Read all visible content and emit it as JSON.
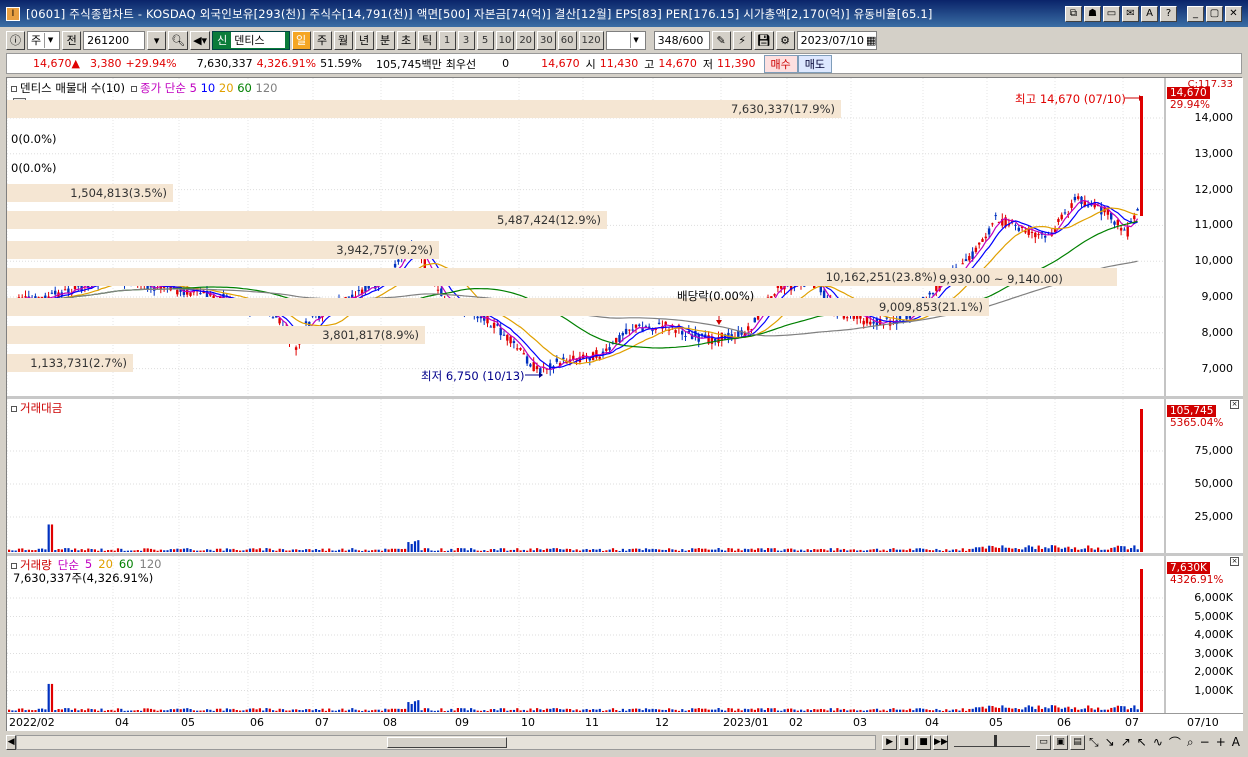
{
  "window": {
    "app_icon": "I",
    "title": "[0601] 주식종합차트 - KOSDAQ 외국인보유[293(천)] 주식수[14,791(천)] 액면[500] 자본금[74(억)] 결산[12월] EPS[83] PER[176.15] 시가총액[2,170(억)] 유동비율[65.1]",
    "title_buttons": [
      "⧉",
      "☗",
      "▭",
      "✉",
      "A",
      "?"
    ],
    "window_controls": [
      "_",
      "▢",
      "✕"
    ]
  },
  "toolbar": {
    "type_select": "주",
    "prev_label": "전",
    "code": "261200",
    "stock_tag": "신",
    "stock_name": "덴티스",
    "periods": [
      "일",
      "주",
      "월",
      "년",
      "분",
      "초",
      "틱"
    ],
    "active_period": "일",
    "intervals": [
      "1",
      "3",
      "5",
      "10",
      "20",
      "30",
      "60",
      "120"
    ],
    "count_value": "348",
    "count_total": "/600",
    "date": "2023/07/10"
  },
  "quote": {
    "price": "14,670",
    "arrow": "▲",
    "change": "3,380",
    "change_pct": "+29.94%",
    "volume": "7,630,337",
    "volume_pct": "4,326.91%",
    "turnover": "51.59%",
    "amount": "105,745백만",
    "bid_label": "최우선",
    "bid_value": "0",
    "ask_value": "14,670",
    "open_label": "시",
    "open": "11,430",
    "high_label": "고",
    "high": "14,670",
    "low_label": "저",
    "low": "11,390",
    "buy_label": "매수",
    "sell_label": "매도"
  },
  "price_pane": {
    "legend_title": "덴티스 매물대 수(10)",
    "ma_label": "종가 단순",
    "ma_periods": [
      {
        "label": "5",
        "color": "#c000c0"
      },
      {
        "label": "10",
        "color": "#0000ff"
      },
      {
        "label": "20",
        "color": "#e0a000"
      },
      {
        "label": "60",
        "color": "#008000"
      },
      {
        "label": "120",
        "color": "#808080"
      }
    ],
    "volume_profile": [
      {
        "label": "7,630,337(17.9%)"
      },
      {
        "label": "0(0.0%)"
      },
      {
        "label": "0(0.0%)"
      },
      {
        "label": "1,504,813(3.5%)"
      },
      {
        "label": "5,487,424(12.9%)"
      },
      {
        "label": "3,942,757(9.2%)"
      },
      {
        "label": "10,162,251(23.8%)"
      },
      {
        "label": "9,009,853(21.1%)"
      },
      {
        "label": "3,801,817(8.9%)"
      },
      {
        "label": "1,133,731(2.7%)"
      }
    ],
    "range_label": "9,930.00 ~ 9,140.00)",
    "high_annotation": "최고 14,670 (07/10)",
    "low_annotation": "최저 6,750 (10/13)",
    "dividend_annotation": "배당락(0.00%)",
    "y_ticks": [
      "14,000",
      "13,000",
      "12,000",
      "11,000",
      "10,000",
      "9,000",
      "8,000",
      "7,000"
    ],
    "top_axis_label": "C:117.33",
    "last_price": "14,670",
    "last_pct": "29.94%"
  },
  "amount_pane": {
    "legend_title": "거래대금",
    "y_ticks": [
      "75,000",
      "50,000",
      "25,000"
    ],
    "last_value": "105,745",
    "last_pct": "5365.04%"
  },
  "volume_pane": {
    "legend_title": "거래량",
    "ma_label": "단순",
    "ma_periods": [
      {
        "label": "5",
        "color": "#c000c0"
      },
      {
        "label": "20",
        "color": "#e0a000"
      },
      {
        "label": "60",
        "color": "#008000"
      },
      {
        "label": "120",
        "color": "#808080"
      }
    ],
    "sub_label": "7,630,337주(4,326.91%)",
    "y_ticks": [
      "6,000K",
      "5,000K",
      "4,000K",
      "3,000K",
      "2,000K",
      "1,000K"
    ],
    "last_value": "7,630K",
    "last_pct": "4326.91%"
  },
  "x_axis": {
    "labels": [
      "2022/02",
      "04",
      "05",
      "06",
      "07",
      "08",
      "09",
      "10",
      "11",
      "12",
      "2023/01",
      "02",
      "03",
      "04",
      "05",
      "06",
      "07"
    ],
    "right_label": "07/10"
  },
  "colors": {
    "up": "#e00000",
    "down": "#0030c0",
    "profile_bg": "#f5e6d3"
  },
  "statusbar": {
    "nav_buttons": [
      "▶",
      "▮",
      "■",
      "▶▶"
    ],
    "zoom_buttons": [
      "−",
      "+",
      "A"
    ]
  }
}
